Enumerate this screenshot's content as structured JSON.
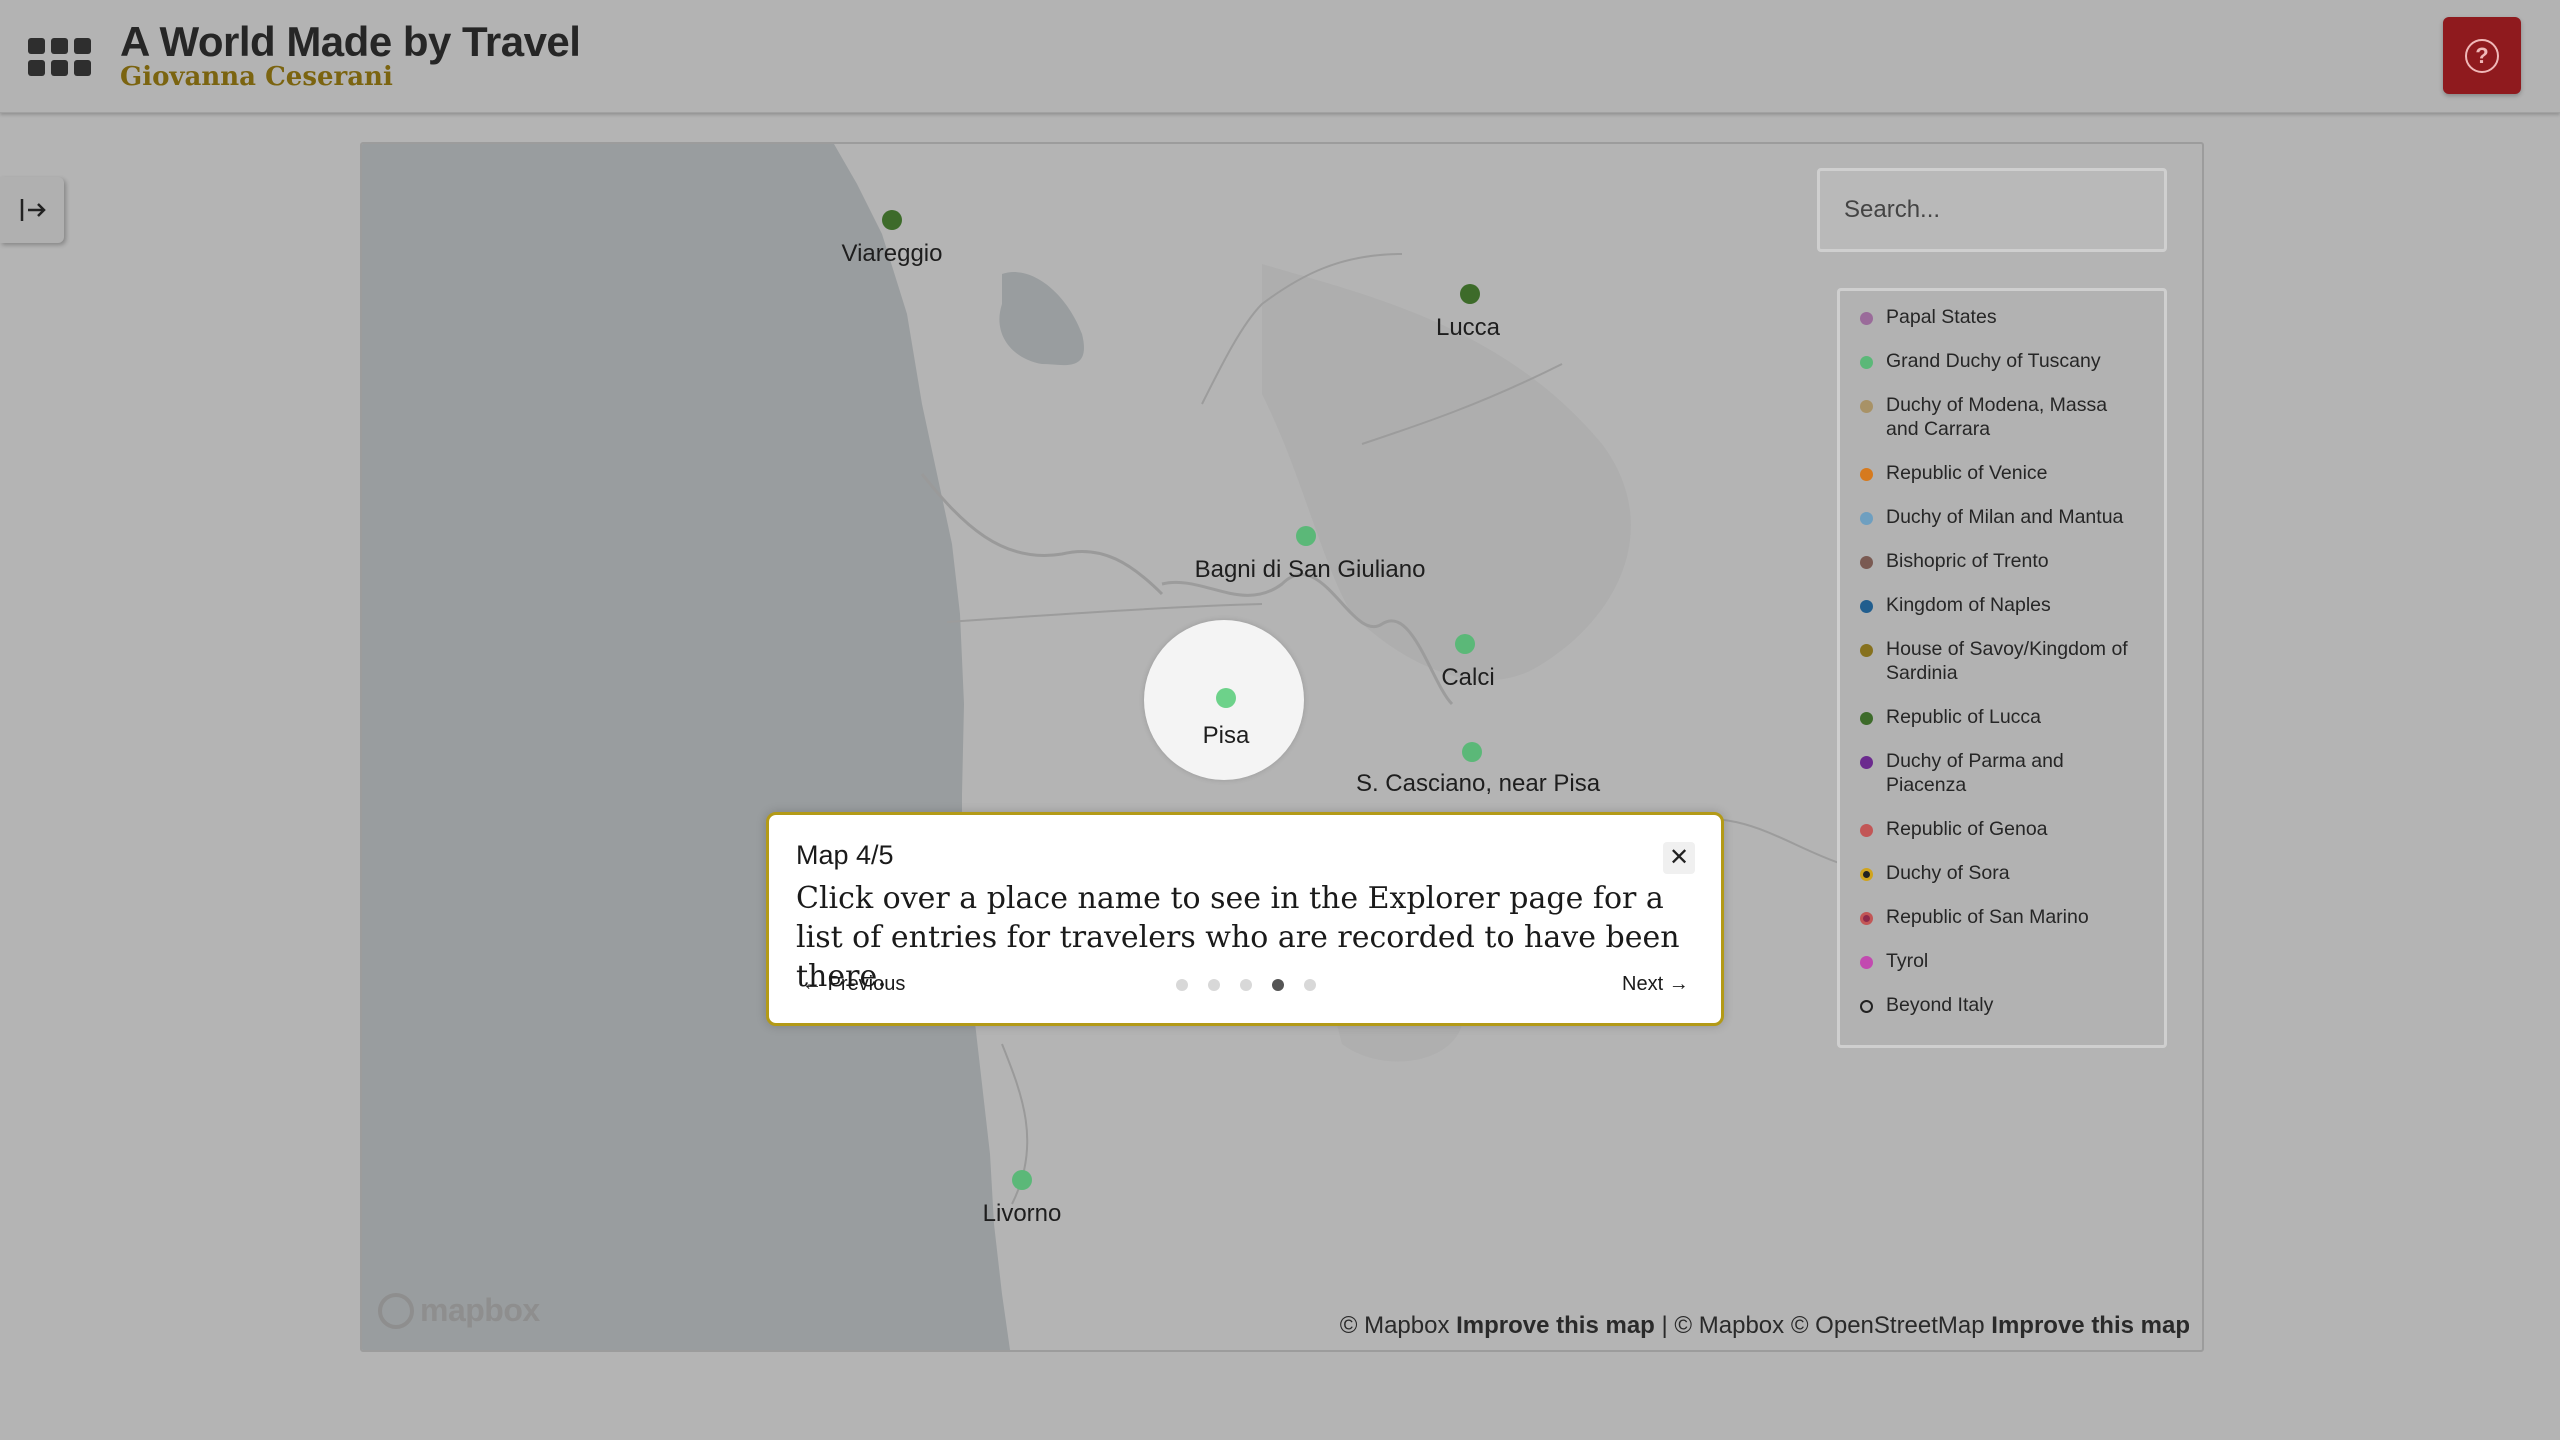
{
  "header": {
    "title": "A World Made by Travel",
    "author": "Giovanna Ceserani",
    "apps_icon": "grid-icon",
    "help_icon": "question-circle-icon",
    "help_color": "#8f1a1e"
  },
  "sidebar_toggle": {
    "icon": "expand-sidebar-icon"
  },
  "map": {
    "search": {
      "placeholder": "Search..."
    },
    "places": [
      {
        "label": "Viareggio",
        "color": "#3d6b2a"
      },
      {
        "label": "Lucca",
        "color": "#3d6b2a"
      },
      {
        "label": "Bagni di San Giuliano",
        "color": "#5bb878"
      },
      {
        "label": "Calci",
        "color": "#5bb878"
      },
      {
        "label": "Pisa",
        "color": "#5bb878"
      },
      {
        "label": "S. Casciano, near Pisa",
        "color": "#5bb878"
      },
      {
        "label": "Livorno",
        "color": "#5bb878"
      }
    ],
    "legend": [
      {
        "label": "Papal States",
        "color": "#9a6b9a"
      },
      {
        "label": "Grand Duchy of Tuscany",
        "color": "#5bb878"
      },
      {
        "label": "Duchy of Modena, Massa and Carrara",
        "color": "#a89266"
      },
      {
        "label": "Republic of Venice",
        "color": "#d67a1e"
      },
      {
        "label": "Duchy of Milan and Mantua",
        "color": "#6e9fc0"
      },
      {
        "label": "Bishopric of Trento",
        "color": "#7a5a52"
      },
      {
        "label": "Kingdom of Naples",
        "color": "#215e8e"
      },
      {
        "label": "House of Savoy/Kingdom of Sardinia",
        "color": "#86711e"
      },
      {
        "label": "Republic of Lucca",
        "color": "#3d6b2a"
      },
      {
        "label": "Duchy of Parma and Piacenza",
        "color": "#6b2a8e"
      },
      {
        "label": "Republic of Genoa",
        "color": "#c25656"
      },
      {
        "label": "Duchy of Sora",
        "color": "#222222",
        "border": "#d0a41e"
      },
      {
        "label": "Republic of San Marino",
        "color": "#8e2a4a",
        "border": "#c25656"
      },
      {
        "label": "Tyrol",
        "color": "#c24ab0"
      },
      {
        "label": "Beyond Italy",
        "color": "transparent",
        "border": "#222222"
      }
    ],
    "logo": "mapbox",
    "attribution": {
      "mapbox_1": "© Mapbox",
      "improve_1": "Improve this map",
      "separator": "|",
      "mapbox_2": "© Mapbox",
      "osm": "© OpenStreetMap",
      "improve_2": "Improve this map"
    }
  },
  "tour": {
    "title": "Map 4/5",
    "body": "Click over a place name to see in the Explorer page for a list of entries for travelers who are recorded to have been there.",
    "previous": "Previous",
    "next": "Next",
    "close_icon": "close-icon",
    "steps": 5,
    "current_step": 4
  }
}
